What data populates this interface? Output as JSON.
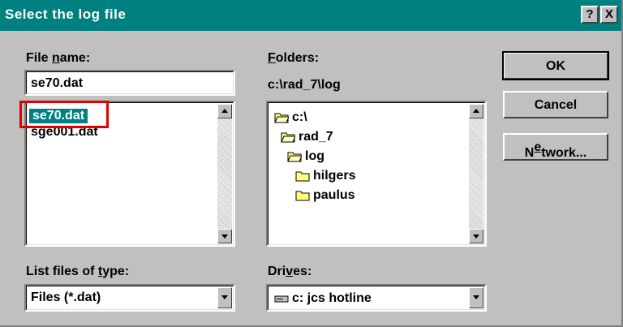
{
  "window": {
    "title": "Select the log file",
    "help_label": "?",
    "close_label": "X"
  },
  "file_name": {
    "label_underlined": "n",
    "label_pre": "File ",
    "label_post": "ame:",
    "value": "se70.dat"
  },
  "file_list": {
    "items": [
      "se70.dat",
      "sge001.dat"
    ],
    "selected_index": 0
  },
  "folders": {
    "label_underlined": "F",
    "label_post": "olders:",
    "current_path": "c:\\rad_7\\log",
    "items": [
      {
        "name": "c:\\",
        "state": "open",
        "indent": 0
      },
      {
        "name": "rad_7",
        "state": "open",
        "indent": 1
      },
      {
        "name": "log",
        "state": "open",
        "indent": 2
      },
      {
        "name": "hilgers",
        "state": "closed",
        "indent": 3
      },
      {
        "name": "paulus",
        "state": "closed",
        "indent": 3
      }
    ]
  },
  "buttons": {
    "ok": "OK",
    "cancel": "Cancel",
    "network_underlined": "e",
    "network_pre": "N",
    "network_post": "twork..."
  },
  "file_type": {
    "label_pre": "List files of ",
    "label_underlined": "t",
    "label_post": "ype:",
    "value": "Files (*.dat)"
  },
  "drives": {
    "label_pre": "Dri",
    "label_underlined": "v",
    "label_post": "es:",
    "value": "c: jcs hotline",
    "icon": "drive-icon"
  },
  "colors": {
    "titlebar": "#008080",
    "face": "#c0c0c0",
    "selection": "#008080",
    "highlight_box": "#e00000"
  }
}
